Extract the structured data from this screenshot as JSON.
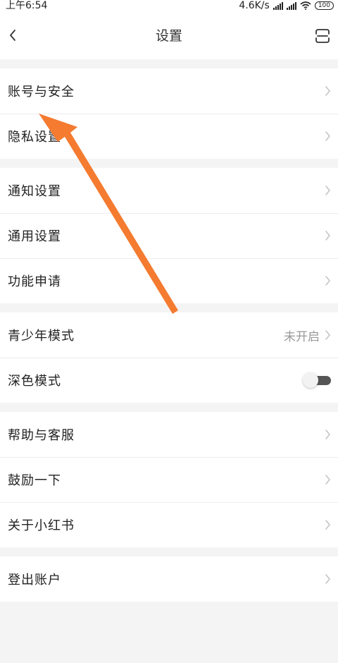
{
  "status_bar": {
    "time": "上午6:54",
    "speed": "4.6K/s",
    "battery": "100"
  },
  "nav": {
    "title": "设置",
    "back_icon": "chevron-left-icon",
    "scan_icon": "scan-icon"
  },
  "groups": [
    {
      "items": [
        {
          "label": "账号与安全"
        },
        {
          "label": "隐私设置"
        }
      ]
    },
    {
      "items": [
        {
          "label": "通知设置"
        },
        {
          "label": "通用设置"
        },
        {
          "label": "功能申请"
        }
      ]
    },
    {
      "items": [
        {
          "label": "青少年模式",
          "value": "未开启"
        },
        {
          "label": "深色模式",
          "toggle": false
        }
      ]
    },
    {
      "items": [
        {
          "label": "帮助与客服"
        },
        {
          "label": "鼓励一下"
        },
        {
          "label": "关于小红书"
        }
      ]
    },
    {
      "items": [
        {
          "label": "登出账户"
        }
      ]
    }
  ],
  "colors": {
    "arrow": "#f47b30",
    "background": "#f4f4f4",
    "chevron": "#c4c4c4"
  }
}
